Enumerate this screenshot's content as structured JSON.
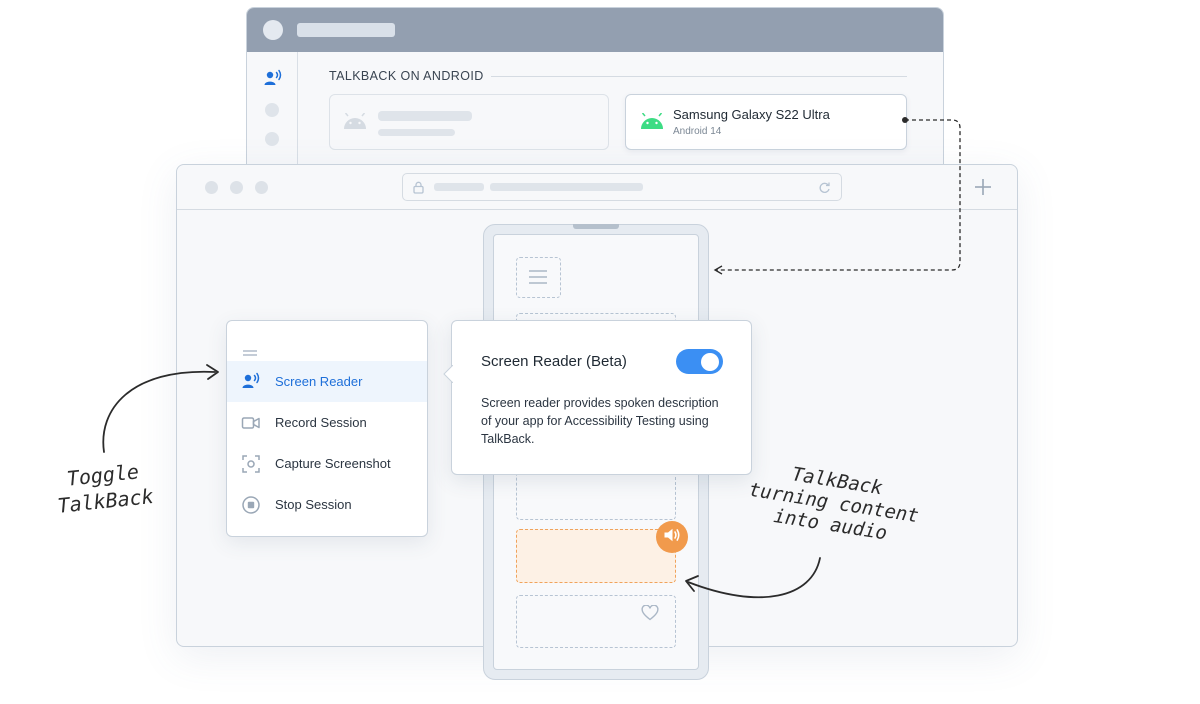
{
  "back_window": {
    "heading": "TALKBACK ON ANDROID",
    "device": {
      "name": "Samsung Galaxy S22 Ultra",
      "os": "Android 14",
      "icon": "android-icon"
    }
  },
  "menu": {
    "items": [
      {
        "label": "Screen Reader",
        "icon": "screen-reader-icon",
        "active": true
      },
      {
        "label": "Record Session",
        "icon": "video-camera-icon",
        "active": false
      },
      {
        "label": "Capture Screenshot",
        "icon": "capture-icon",
        "active": false
      },
      {
        "label": "Stop Session",
        "icon": "stop-icon",
        "active": false
      }
    ]
  },
  "popover": {
    "title": "Screen Reader (Beta)",
    "toggle_on": true,
    "description": "Screen reader provides spoken description of your app for Accessibility Testing using TalkBack."
  },
  "annotations": {
    "toggle_line1": "Toggle",
    "toggle_line2": "TalkBack",
    "audio_line1": "TalkBack",
    "audio_line2": "turning content",
    "audio_line3": "into audio"
  },
  "colors": {
    "accent_blue": "#3b8ff3",
    "android_green": "#3ddc84",
    "highlight_orange": "#f19a4c"
  }
}
